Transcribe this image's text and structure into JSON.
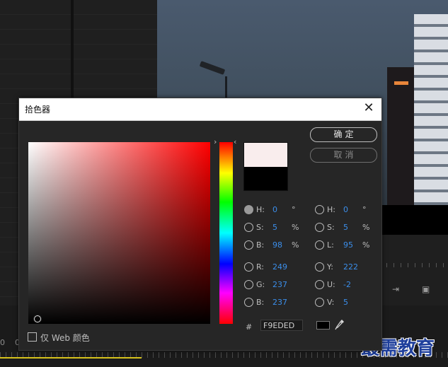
{
  "dialog": {
    "title": "拾色器",
    "ok_label": "确定",
    "cancel_label": "取消",
    "hex_symbol": "#",
    "hex_value": "F9EDED",
    "web_only_label": "仅 Web 颜色"
  },
  "colors": {
    "new_color": "#F9EDED",
    "old_color": "#000000",
    "value_color": "#3b8eea"
  },
  "params_left": [
    {
      "label": "H:",
      "value": "0",
      "unit": "°",
      "selected": true
    },
    {
      "label": "S:",
      "value": "5",
      "unit": "%",
      "selected": false
    },
    {
      "label": "B:",
      "value": "98",
      "unit": "%",
      "selected": false
    },
    {
      "label": "R:",
      "value": "249",
      "unit": "",
      "selected": false
    },
    {
      "label": "G:",
      "value": "237",
      "unit": "",
      "selected": false
    },
    {
      "label": "B:",
      "value": "237",
      "unit": "",
      "selected": false
    }
  ],
  "params_right": [
    {
      "label": "H:",
      "value": "0",
      "unit": "°",
      "selected": false
    },
    {
      "label": "S:",
      "value": "5",
      "unit": "%",
      "selected": false
    },
    {
      "label": "L:",
      "value": "95",
      "unit": "%",
      "selected": false
    },
    {
      "label": "Y:",
      "value": "222",
      "unit": "",
      "selected": false
    },
    {
      "label": "U:",
      "value": "-2",
      "unit": "",
      "selected": false
    },
    {
      "label": "V:",
      "value": "5",
      "unit": "",
      "selected": false
    }
  ],
  "icons": {
    "hue_arrow_left": "›",
    "hue_arrow_right": "‹",
    "close": "✕"
  },
  "background": {
    "timeline_numbers": [
      "0",
      "0"
    ],
    "watermark": "最需教育"
  }
}
